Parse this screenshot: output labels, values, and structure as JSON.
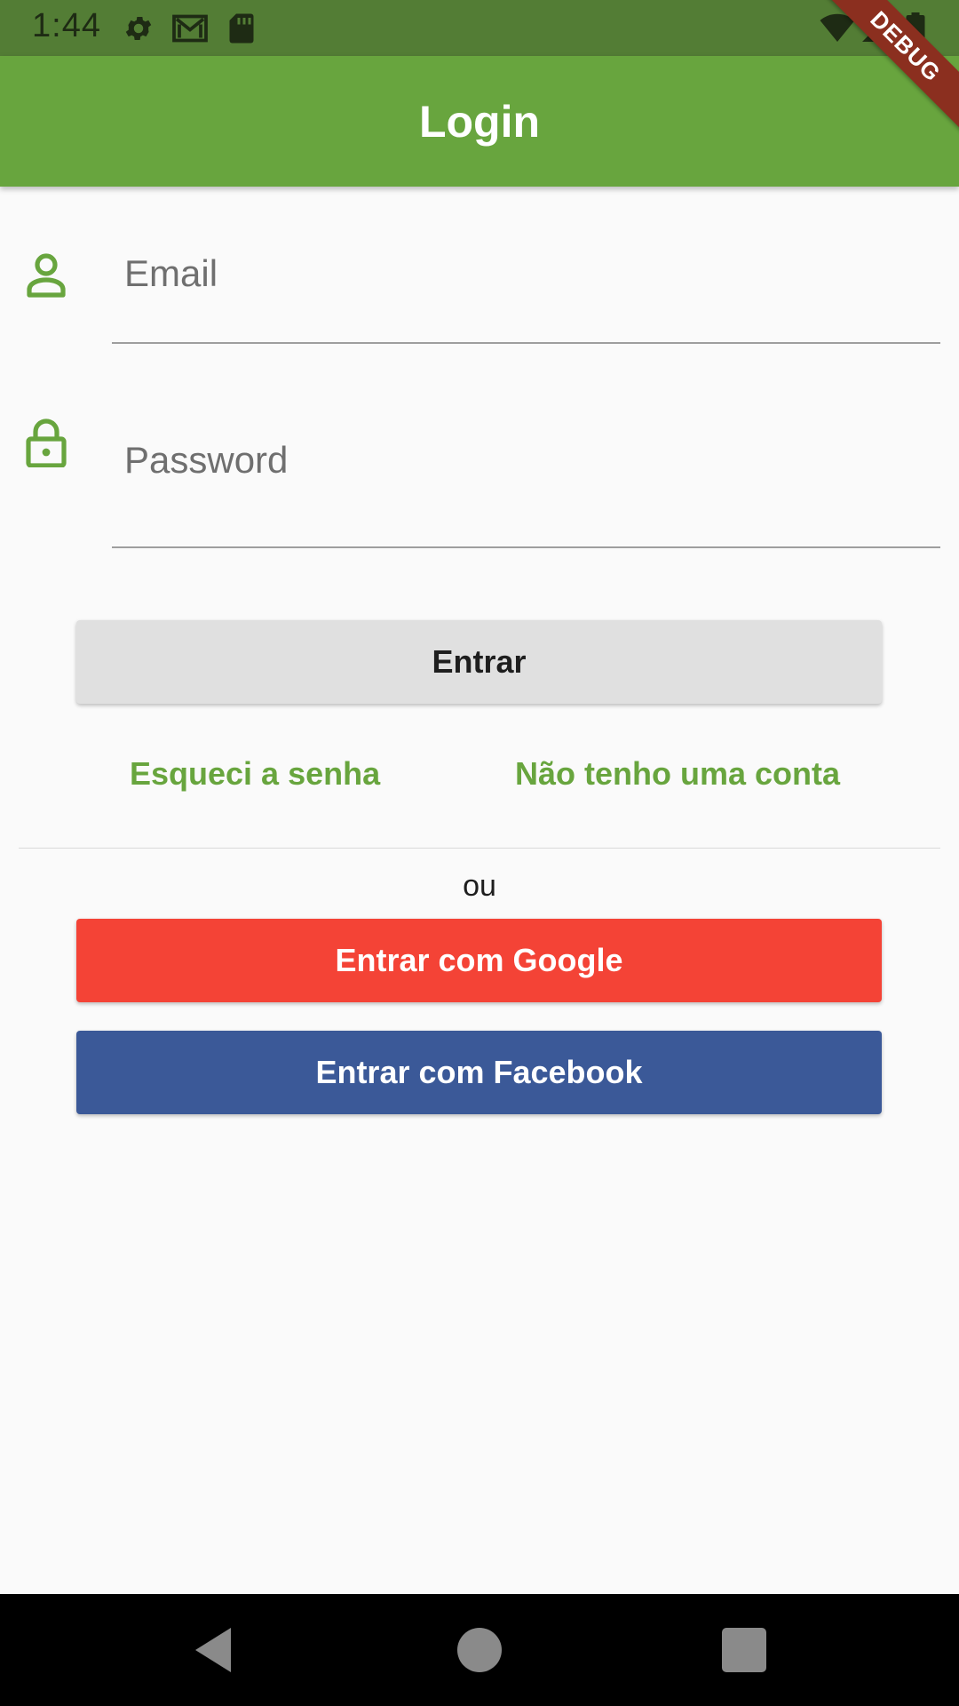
{
  "status_bar": {
    "time": "1:44",
    "icons": [
      "settings-icon",
      "gmail-icon",
      "sd-card-icon",
      "wifi-icon",
      "signal-icon",
      "battery-icon"
    ]
  },
  "app_bar": {
    "title": "Login",
    "debug_label": "DEBUG"
  },
  "form": {
    "email_placeholder": "Email",
    "password_placeholder": "Password",
    "submit_label": "Entrar"
  },
  "links": {
    "forgot_password": "Esqueci a senha",
    "no_account": "Não tenho uma conta"
  },
  "separator_text": "ou",
  "social": {
    "google_label": "Entrar com Google",
    "facebook_label": "Entrar com Facebook"
  },
  "colors": {
    "primary": "#68a53e",
    "primary_dark": "#537d35",
    "google": "#f44336",
    "facebook": "#3b5998",
    "button_grey": "#e0e0e0"
  },
  "nav_bar": {
    "buttons": [
      "back-icon",
      "home-icon",
      "recents-icon"
    ]
  }
}
